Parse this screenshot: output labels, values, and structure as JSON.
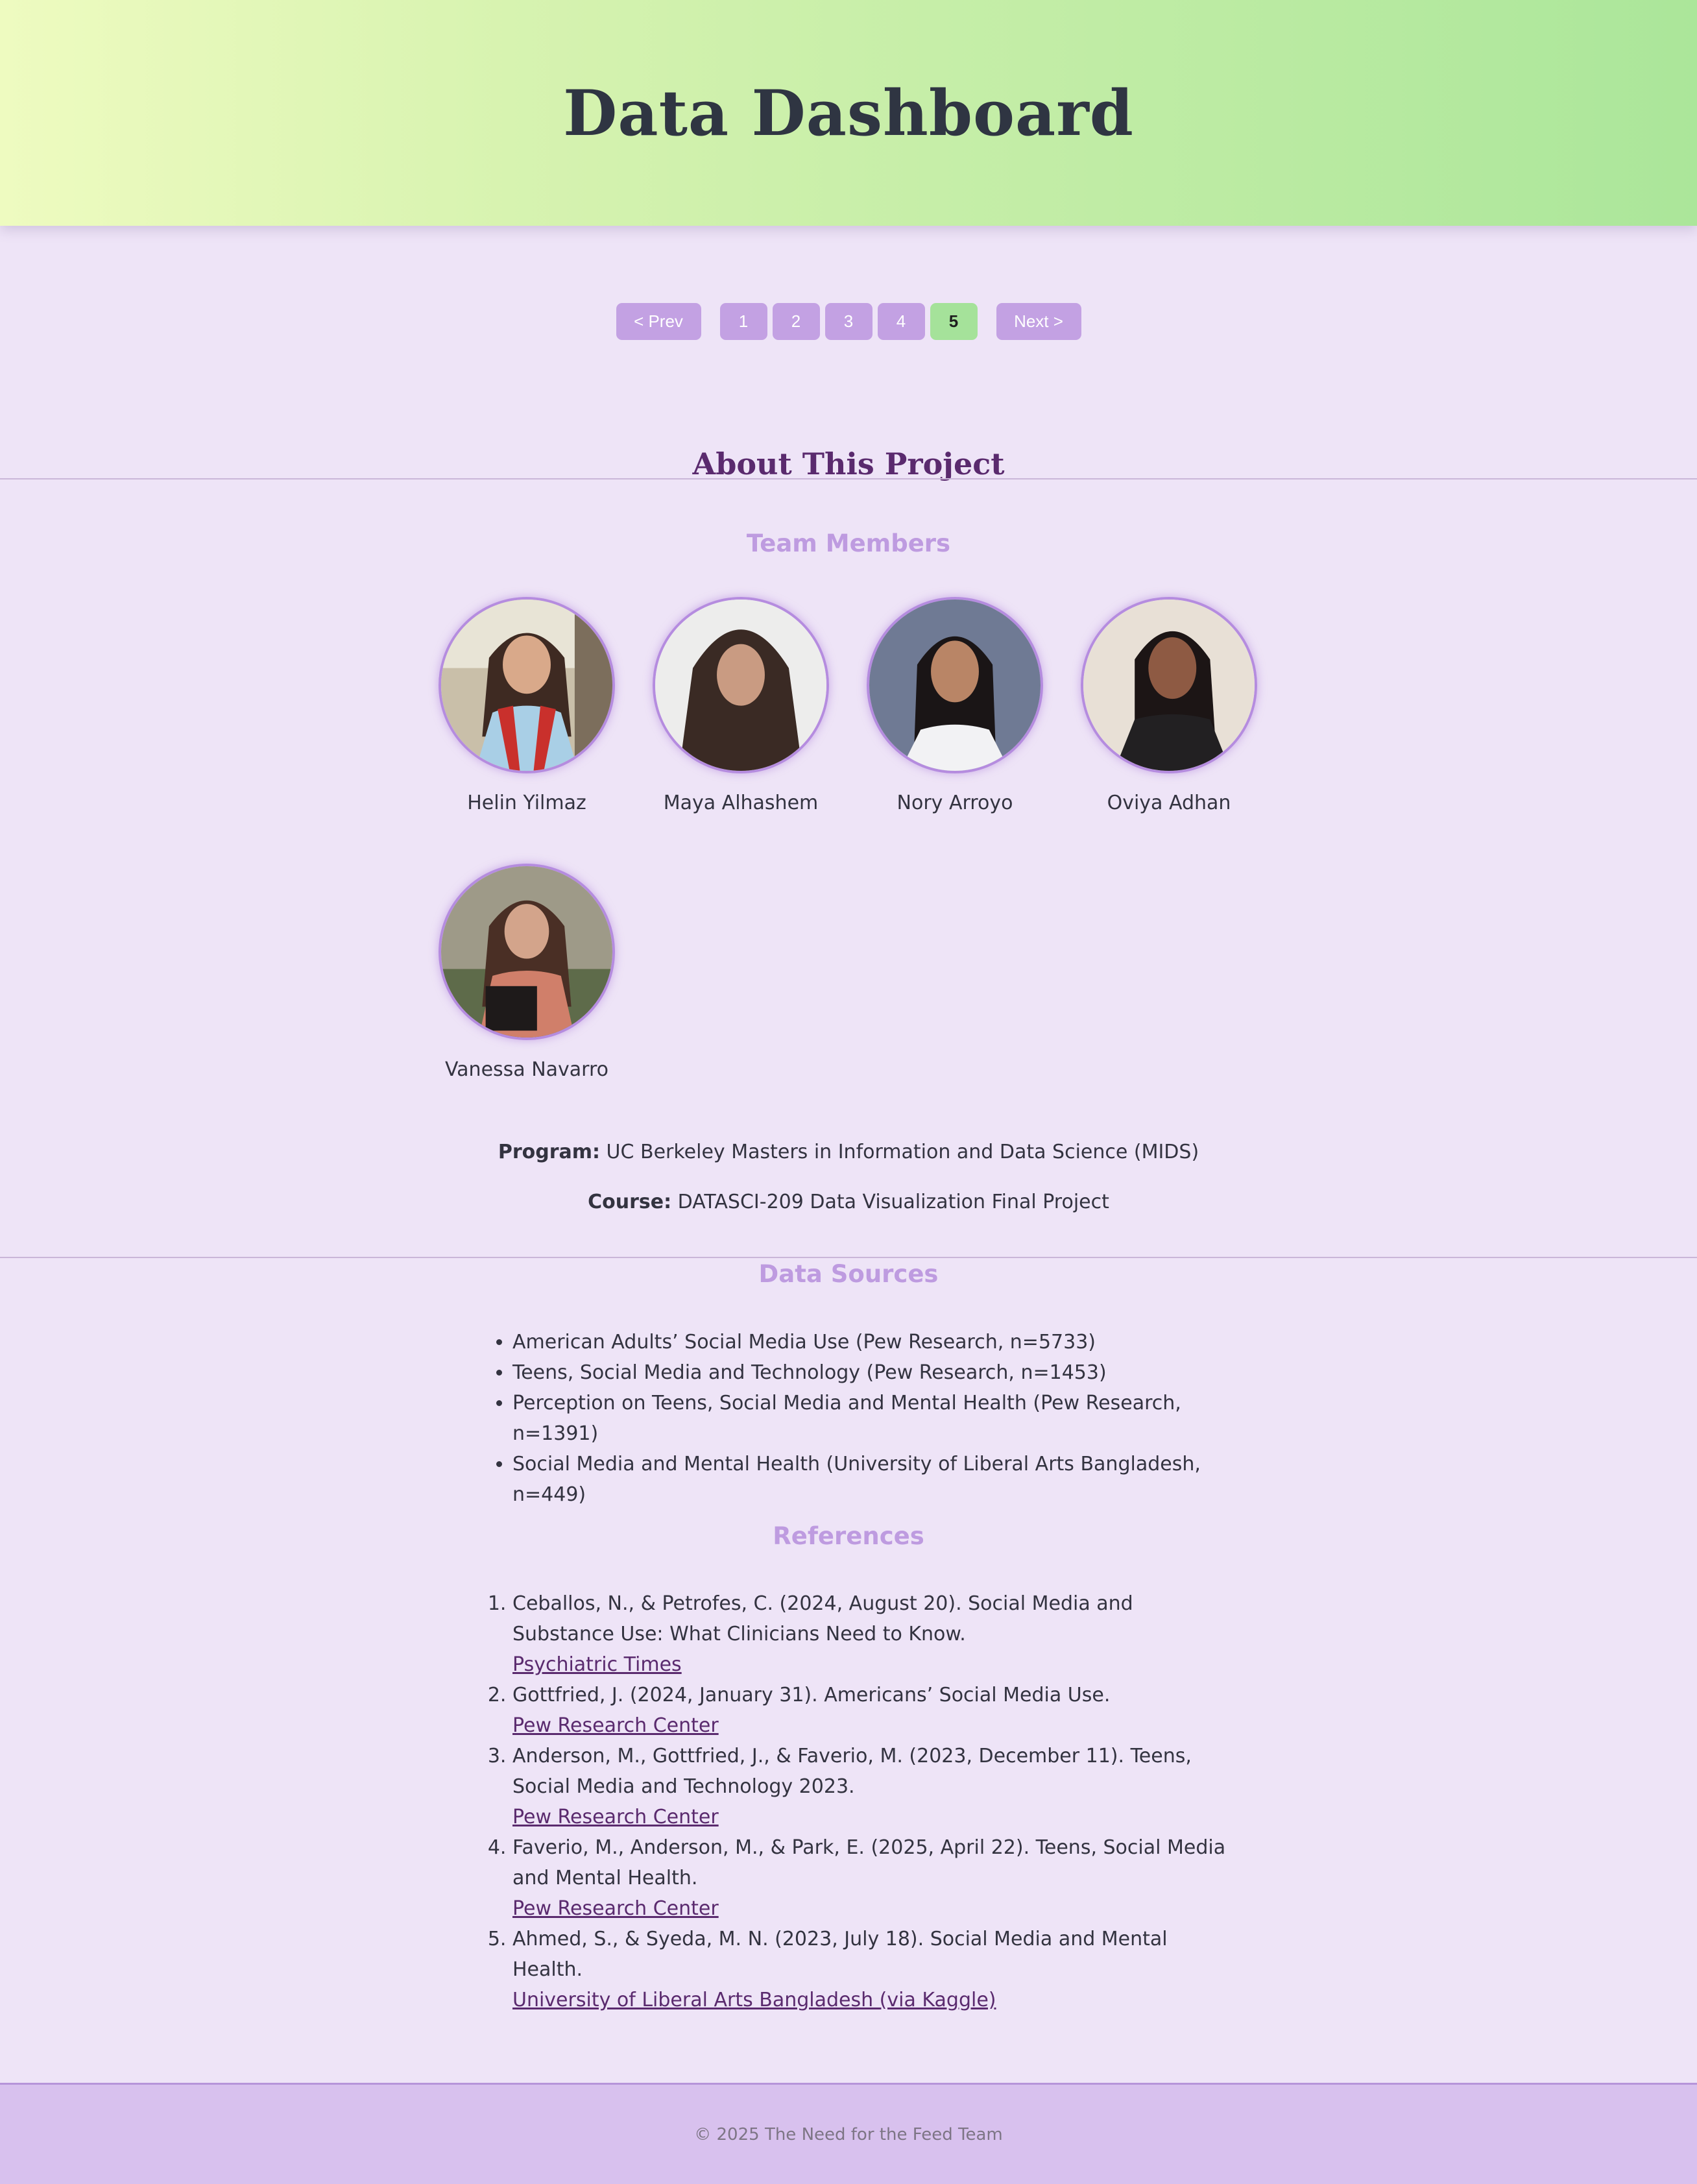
{
  "header": {
    "title": "Data Dashboard"
  },
  "pagination": {
    "prev_label": "< Prev",
    "next_label": "Next >",
    "pages": [
      "1",
      "2",
      "3",
      "4",
      "5"
    ],
    "current_page": "5"
  },
  "about": {
    "title": "About This Project",
    "team_heading": "Team Members",
    "members": [
      {
        "name": "Helin Yilmaz"
      },
      {
        "name": "Maya Alhashem"
      },
      {
        "name": "Nory Arroyo"
      },
      {
        "name": "Oviya Adhan"
      },
      {
        "name": "Vanessa Navarro"
      }
    ],
    "program_label": "Program:",
    "program_value": "UC Berkeley Masters in Information and Data Science (MIDS)",
    "course_label": "Course:",
    "course_value": "DATASCI-209 Data Visualization Final Project"
  },
  "data_sources": {
    "heading": "Data Sources",
    "items": [
      "American Adults’ Social Media Use (Pew Research, n=5733)",
      "Teens, Social Media and Technology (Pew Research, n=1453)",
      "Perception on Teens, Social Media and Mental Health (Pew Research, n=1391)",
      "Social Media and Mental Health (University of Liberal Arts Bangladesh, n=449)"
    ]
  },
  "references": {
    "heading": "References",
    "items": [
      {
        "text": "Ceballos, N., & Petrofes, C. (2024, August 20). Social Media and Substance Use: What Clinicians Need to Know.",
        "link": "Psychiatric Times"
      },
      {
        "text": "Gottfried, J. (2024, January 31). Americans’ Social Media Use.",
        "link": "Pew Research Center"
      },
      {
        "text": "Anderson, M., Gottfried, J., & Faverio, M. (2023, December 11). Teens, Social Media and Technology 2023.",
        "link": "Pew Research Center"
      },
      {
        "text": "Faverio, M., Anderson, M., & Park, E. (2025, April 22). Teens, Social Media and Mental Health.",
        "link": "Pew Research Center"
      },
      {
        "text": "Ahmed, S., & Syeda, M. N. (2023, July 18). Social Media and Mental Health.",
        "link": "University of Liberal Arts Bangladesh (via Kaggle)"
      }
    ]
  },
  "footer": {
    "text": "© 2025 The Need for the Feed Team"
  },
  "colors": {
    "accent": "#C3A1E3",
    "active_page": "#A5E29A",
    "title": "#5A2A6E",
    "subheading": "#BE9BE0",
    "background": "#EEE4F7"
  }
}
